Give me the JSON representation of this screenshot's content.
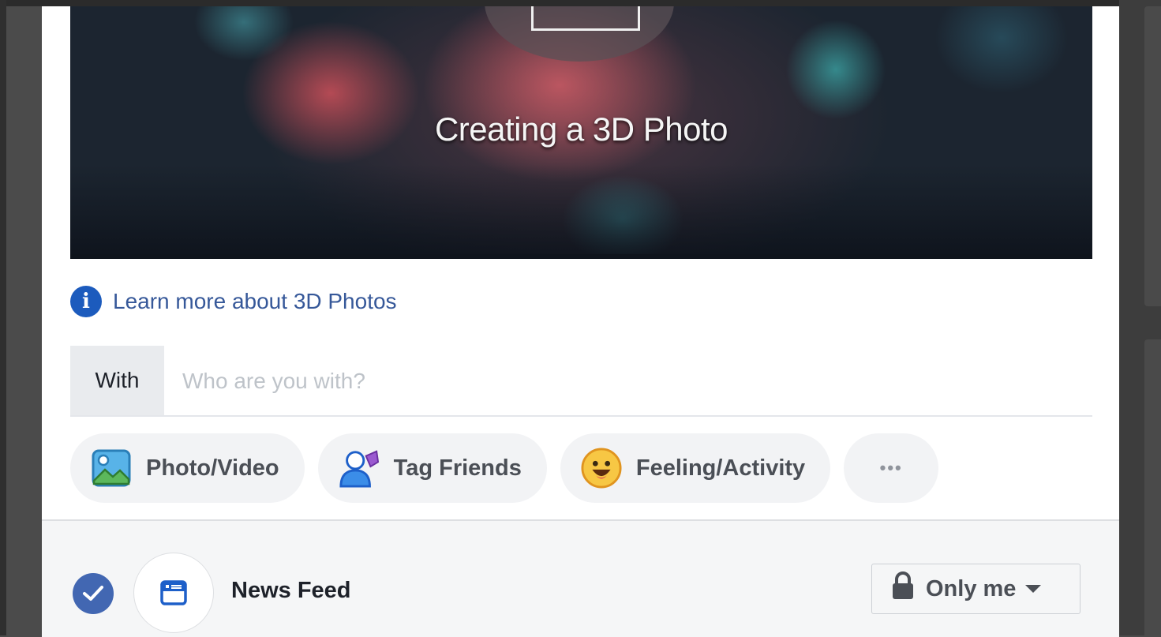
{
  "photo": {
    "title": "Creating a 3D Photo"
  },
  "learn_more": {
    "text": "Learn more about 3D Photos",
    "icon": "info-icon",
    "color": "#365899"
  },
  "with": {
    "label": "With",
    "placeholder": "Who are you with?"
  },
  "actions": [
    {
      "label": "Photo/Video",
      "icon": "photo-icon"
    },
    {
      "label": "Tag Friends",
      "icon": "tag-friends-icon"
    },
    {
      "label": "Feeling/Activity",
      "icon": "feeling-emoji-icon"
    },
    {
      "label": "•••",
      "icon": "more-icon"
    }
  ],
  "footer": {
    "destination": "News Feed",
    "privacy": "Only me",
    "accent": "#4267b2"
  }
}
